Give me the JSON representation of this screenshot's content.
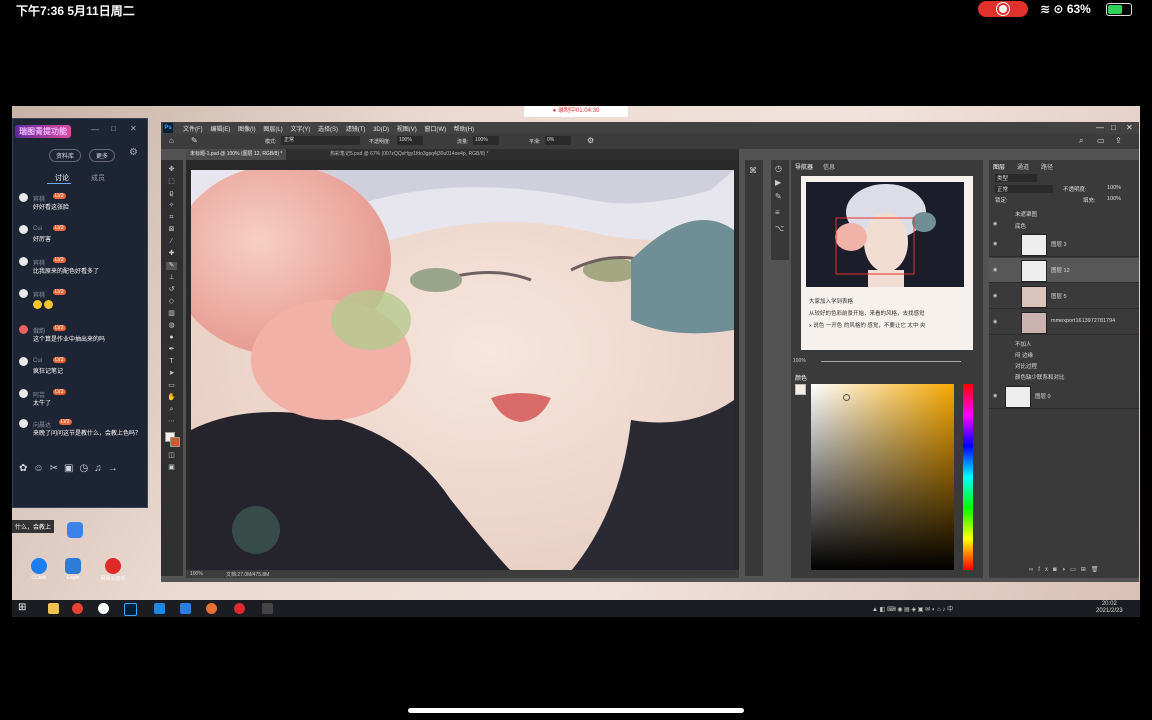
{
  "status_bar": {
    "time_date": "下午7:36   5月11日周二",
    "battery_text": "63%",
    "battery_level": 0.63
  },
  "screen": {
    "recording_badge": "● 录制中01:04:30",
    "chat": {
      "title": "瑞图青提功能",
      "buttons": [
        "资料库",
        "更多"
      ],
      "tabs": [
        "讨论",
        "成员"
      ],
      "messages": [
        {
          "name": "宾桃",
          "text": "好好看这张脸"
        },
        {
          "name": "Cui",
          "text": "好厉害"
        },
        {
          "name": "宾桃",
          "text": "比我原来的配色好看多了"
        },
        {
          "name": "宾桃",
          "text": ""
        },
        {
          "name": "俄韵",
          "text": "这个算是作业中抽出来的吗"
        },
        {
          "name": "Cui",
          "text": "疯狂记笔记"
        },
        {
          "name": "阿芸",
          "text": "太牛了"
        },
        {
          "name": "向晨达",
          "text": "来晚了问问这节是教什么，会教上色吗？"
        }
      ],
      "level_badge": "LV2"
    },
    "desktop_icons": [
      "CCtalk",
      "Eagle",
      "网易云音乐"
    ],
    "popup_text": "什么，会教上",
    "photoshop": {
      "menu": [
        "文件(F)",
        "编辑(E)",
        "图像(I)",
        "图层(L)",
        "文字(Y)",
        "选择(S)",
        "滤镜(T)",
        "3D(D)",
        "视图(V)",
        "窗口(W)",
        "帮助(H)"
      ],
      "options": {
        "mode_label": "模式:",
        "mode_value": "正常",
        "opacity_label": "不透明度:",
        "opacity_value": "100%",
        "flow_label": "流量:",
        "flow_value": "100%",
        "smooth_label": "平滑:",
        "smooth_value": "0%"
      },
      "tabs": [
        "未标题-1.psd @ 100% (图层 12, RGB/8) *",
        "热彩笔记5.psd @ 67% (007zQQsHgy1fdo3gpq4j30u014oe4p, RGB/8) *"
      ],
      "statusbar": {
        "zoom": "100%",
        "doc": "文档:27.0M/475.8M"
      },
      "navigator": {
        "tabs": [
          "导航器",
          "信息"
        ],
        "note_lines": [
          "大家加入学到表格",
          "从较好的色彩前景开始，来看的风格，去找感觉",
          "x 说色 一开色 的风格的 感觉，不要让它 太中 央"
        ],
        "zoom": "100%"
      },
      "color_panel_title": "颜色",
      "layers": {
        "tabs": [
          "图层",
          "通道",
          "路径"
        ],
        "kind_label": "类型",
        "blend_mode": "正常",
        "opacity_label": "不透明度:",
        "opacity_value": "100%",
        "lock_label": "锁定:",
        "fill_label": "填充:",
        "fill_value": "100%",
        "top_group": "未遮罩图",
        "group_open": "底色",
        "items": [
          {
            "name": "图层 3",
            "selected": false
          },
          {
            "name": "图层 12",
            "selected": true
          },
          {
            "name": "图层 5",
            "selected": false
          },
          {
            "name": "mmexport1613972781794",
            "selected": false
          }
        ],
        "groups": [
          "不加人",
          "闷 边缘",
          "对比过程",
          "颜色缺少联系和对比"
        ],
        "bottom_layer": "图层 0"
      }
    },
    "taskbar_clock": {
      "time": "20:02",
      "date": "2021/2/23"
    }
  }
}
